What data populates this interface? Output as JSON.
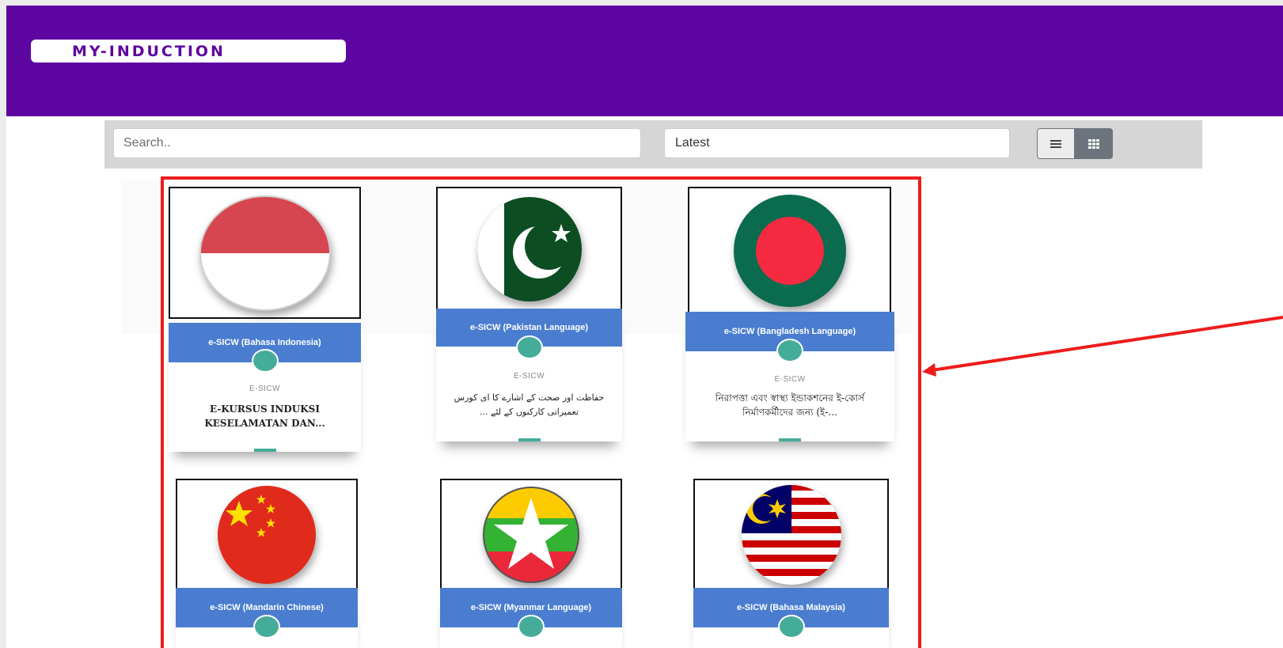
{
  "brand": {
    "logo_text": "MY-INDUCTION",
    "header_color": "#5e06a1"
  },
  "toolbar": {
    "search_placeholder": "Search..",
    "sort_value": "Latest",
    "view_list_icon": "list-icon",
    "view_grid_icon": "grid-icon",
    "active_view": "grid"
  },
  "courses": [
    {
      "band": "e-SICW (Bahasa Indonesia)",
      "category": "E-SICW",
      "title": "E-KURSUS INDUKSI KESELAMATAN DAN...",
      "flag": "indonesia-flag-icon"
    },
    {
      "band": "e-SICW (Pakistan Language)",
      "category": "E-SICW",
      "title": "حفاظت اور صحت کے اشارے کا ای کورس تعمیراتی کارکنوں کے لئے ...",
      "flag": "pakistan-flag-icon"
    },
    {
      "band": "e-SICW (Bangladesh Language)",
      "category": "E-SICW",
      "title": "নিরাপত্তা এবং স্বাস্থ্য ইন্ডাকশনের ই-কোর্স নির্মাণকর্মীদের জন্য (ই-...",
      "flag": "bangladesh-flag-icon"
    },
    {
      "band": "e-SICW (Mandarin Chinese)",
      "flag": "china-flag-icon"
    },
    {
      "band": "e-SICW (Myanmar Language)",
      "flag": "myanmar-flag-icon"
    },
    {
      "band": "e-SICW (Bahasa Malaysia)",
      "flag": "malaysia-flag-icon"
    }
  ],
  "colors": {
    "card_band": "#4a7dcf",
    "card_dot": "#46ac9a",
    "highlight": "#ee1c1c"
  }
}
